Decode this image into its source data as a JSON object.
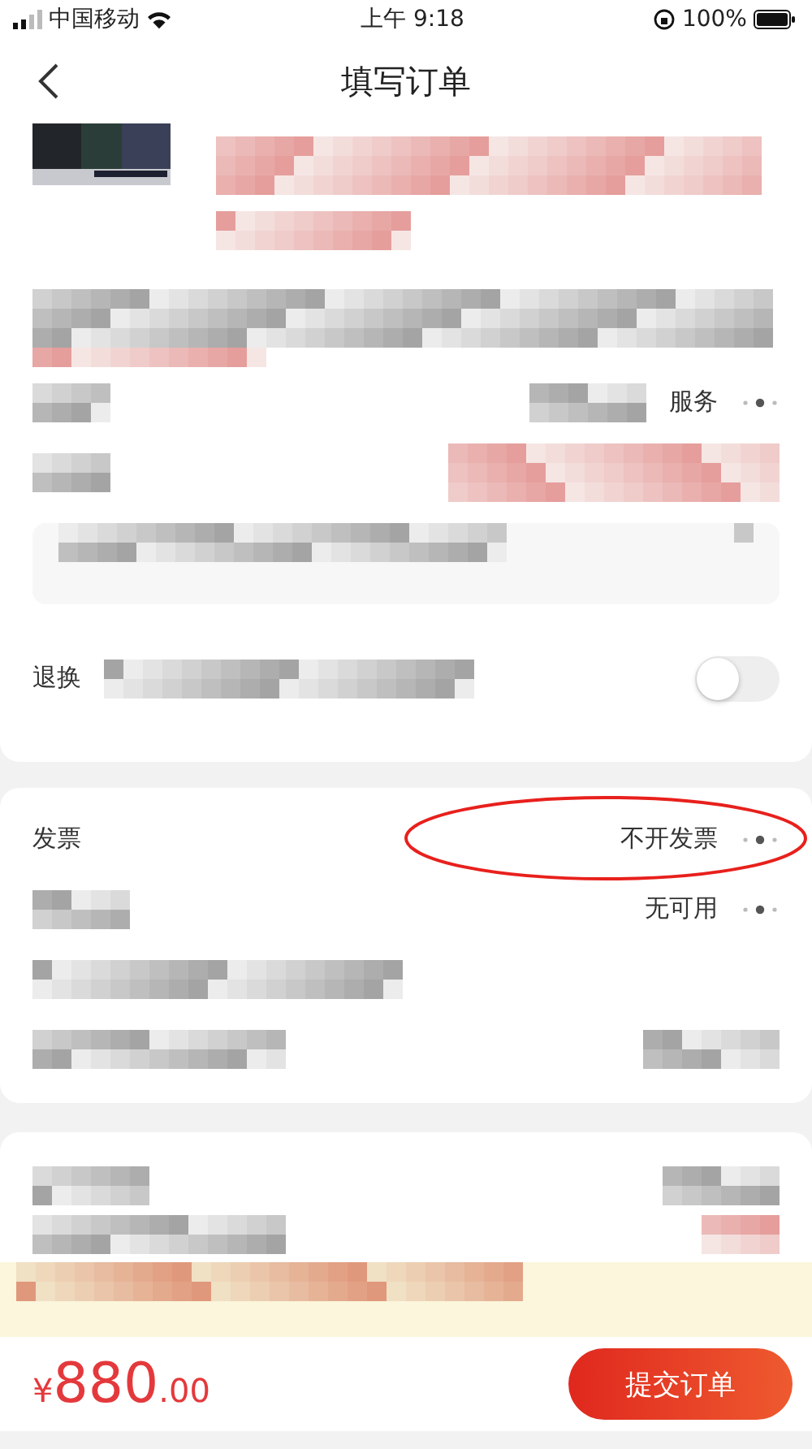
{
  "status_bar": {
    "carrier": "中国移动",
    "time": "上午 9:18",
    "battery": "100%"
  },
  "nav": {
    "title": "填写订单"
  },
  "service_row": {
    "value": "服务"
  },
  "return_row": {
    "label": "退换",
    "on": false
  },
  "invoice_rows": [
    {
      "label": "发票",
      "value": "不开发票",
      "circled": true
    },
    {
      "value": "无可用",
      "circled": false
    }
  ],
  "footer": {
    "currency": "¥",
    "amount": "880",
    "decimals": ".00",
    "submit": "提交订单"
  }
}
